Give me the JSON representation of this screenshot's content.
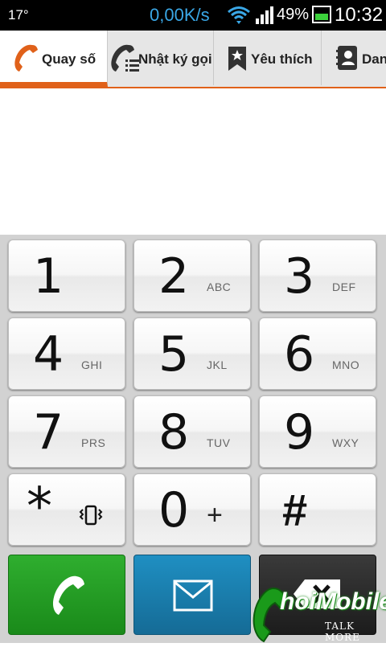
{
  "status_bar": {
    "temperature": "17°",
    "net_speed": "0,00K/s",
    "battery_percent": "49%",
    "battery_level": 0.49,
    "time": "10:32"
  },
  "tabs": [
    {
      "label": "Quay số",
      "icon": "phone-icon",
      "active": true
    },
    {
      "label": "Nhật ký gọi",
      "icon": "call-log-icon",
      "active": false
    },
    {
      "label": "Yêu thích",
      "icon": "star-bookmark-icon",
      "active": false
    },
    {
      "label": "Dan",
      "icon": "contacts-icon",
      "active": false
    }
  ],
  "keypad": {
    "keys": [
      {
        "digit": "1",
        "letters": ""
      },
      {
        "digit": "2",
        "letters": "ABC"
      },
      {
        "digit": "3",
        "letters": "DEF"
      },
      {
        "digit": "4",
        "letters": "GHI"
      },
      {
        "digit": "5",
        "letters": "JKL"
      },
      {
        "digit": "6",
        "letters": "MNO"
      },
      {
        "digit": "7",
        "letters": "PRS"
      },
      {
        "digit": "8",
        "letters": "TUV"
      },
      {
        "digit": "9",
        "letters": "WXY"
      },
      {
        "digit": "*",
        "letters": ""
      },
      {
        "digit": "0",
        "letters": "+"
      },
      {
        "digit": "#",
        "letters": ""
      }
    ]
  },
  "actions": {
    "call_icon": "phone-call-icon",
    "message_icon": "envelope-icon",
    "delete_icon": "backspace-icon"
  },
  "watermark": {
    "brand": "hoiMobile",
    "tagline": "TALK MORE"
  },
  "colors": {
    "accent": "#e0611a",
    "call_green": "#1f9a1f",
    "message_blue": "#1a7fb0",
    "speed_blue": "#3aa7e6"
  }
}
